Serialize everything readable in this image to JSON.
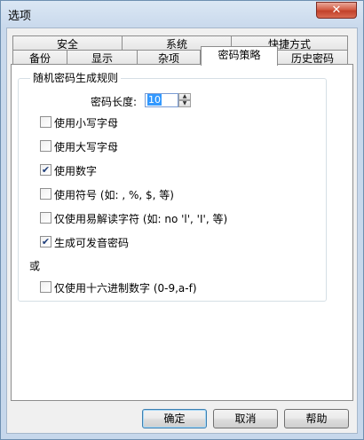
{
  "window": {
    "title": "选项",
    "close_glyph": "✕"
  },
  "tabs_back": [
    "安全",
    "系统",
    "快捷方式"
  ],
  "tabs_front": [
    "备份",
    "显示",
    "杂项",
    "密码策略",
    "历史密码"
  ],
  "active_tab": "密码策略",
  "group": {
    "title": "随机密码生成规则",
    "length_label": "密码长度:",
    "length_value": "10"
  },
  "options": [
    {
      "label": "使用小写字母",
      "checked": false
    },
    {
      "label": "使用大写字母",
      "checked": false
    },
    {
      "label": "使用数字",
      "checked": true
    },
    {
      "label": "使用符号 (如: , %, $, 等)",
      "checked": false
    },
    {
      "label": "仅使用易解读字符 (如: no  'l', 'I', 等)",
      "checked": false
    },
    {
      "label": "生成可发音密码",
      "checked": true
    }
  ],
  "or_label": "或",
  "hex_option": {
    "label": "仅使用十六进制数字 (0-9,a-f)",
    "checked": false
  },
  "buttons": {
    "ok": "确定",
    "cancel": "取消",
    "help": "帮助"
  },
  "icons": {
    "checkbox_checked": "✔",
    "spin_up": "▲",
    "spin_down": "▼"
  }
}
